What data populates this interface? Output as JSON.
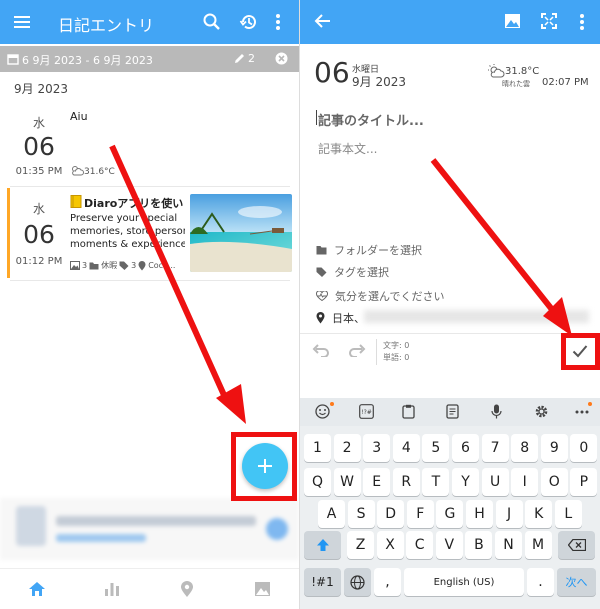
{
  "left": {
    "title": "日記エントリ",
    "filter_range": "6 9月 2023 - 6 9月 2023",
    "filter_count": "2",
    "month_label": "9月 2023",
    "entries": [
      {
        "dow": "水",
        "day": "06",
        "time": "01:35 PM",
        "title": "Aiu",
        "weather": "31.6°C"
      },
      {
        "dow": "水",
        "day": "06",
        "time": "01:12 PM",
        "title": "Diaroアプリを使い",
        "body1": "Preserve your special",
        "body2": "memories, store personal",
        "body3": "moments & experiences,",
        "photos": "3",
        "folder": "休暇",
        "tags": "3",
        "location": "Coco..."
      }
    ],
    "colors": {
      "accent": "#42a5f5",
      "entry_bar": "#ffa726",
      "fab": "#42c5f5",
      "annotation": "#ee1111"
    }
  },
  "right": {
    "day": "06",
    "dow": "水曜日",
    "month": "9月 2023",
    "weather_temp": "31.8°C",
    "weather_desc": "晴れた雲",
    "time": "02:07 PM",
    "title_placeholder": "記事のタイトル...",
    "body_placeholder": "記事本文...",
    "folder_label": "フォルダーを選択",
    "tag_label": "タグを選択",
    "mood_label": "気分を選んでください",
    "location_label": "日本、",
    "char_count": "文字: 0",
    "word_count": "単語: 0"
  },
  "keyboard": {
    "row1": [
      "1",
      "2",
      "3",
      "4",
      "5",
      "6",
      "7",
      "8",
      "9",
      "0"
    ],
    "row2": [
      "Q",
      "W",
      "E",
      "R",
      "T",
      "Y",
      "U",
      "I",
      "O",
      "P"
    ],
    "row3": [
      "A",
      "S",
      "D",
      "F",
      "G",
      "H",
      "J",
      "K",
      "L"
    ],
    "row4": [
      "Z",
      "X",
      "C",
      "V",
      "B",
      "N",
      "M"
    ],
    "sym": "!#1",
    "comma": ",",
    "space": "English (US)",
    "period": ".",
    "next": "次へ"
  }
}
